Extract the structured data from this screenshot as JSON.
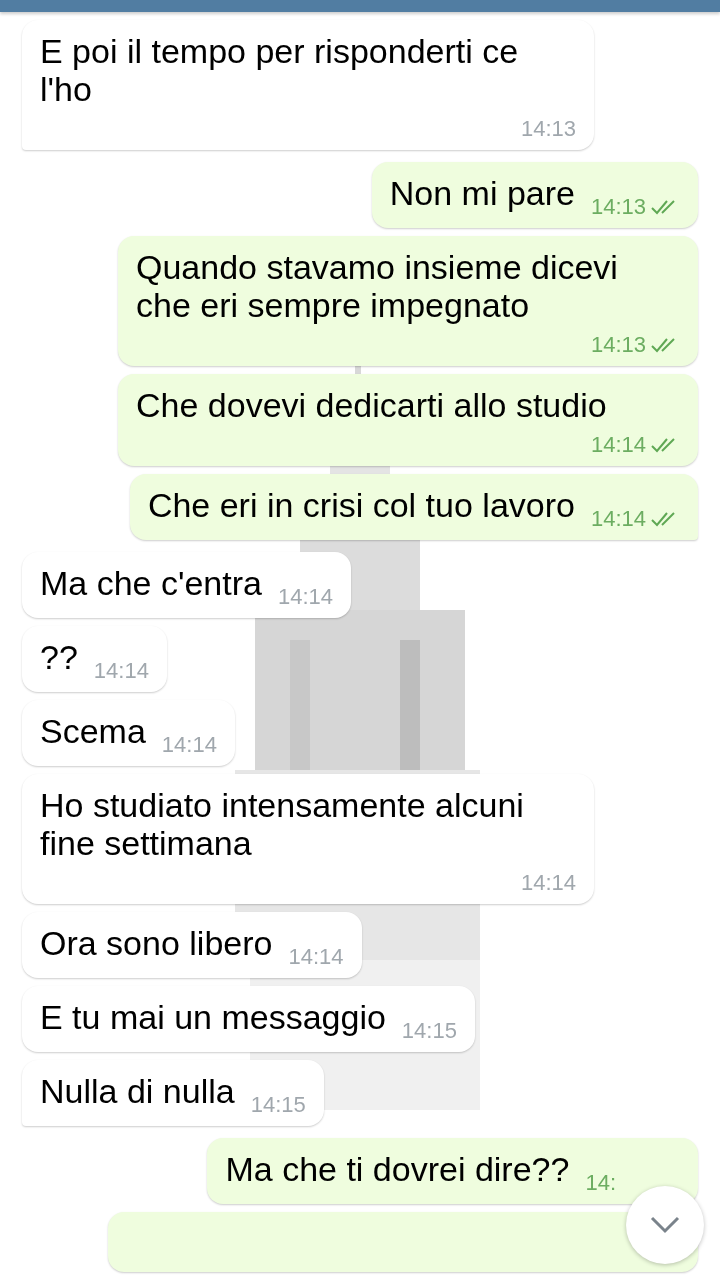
{
  "messages": [
    {
      "kind": "in",
      "text": "E poi il tempo per risponderti ce l'ho",
      "time": "14:13",
      "tail": true
    },
    {
      "kind": "out",
      "text": "Non mi pare",
      "time": "14:13",
      "read": true,
      "tail": false
    },
    {
      "kind": "out",
      "text": "Quando stavamo insieme dicevi che eri sempre impegnato",
      "time": "14:13",
      "read": true,
      "tail": false
    },
    {
      "kind": "out",
      "text": "Che dovevi dedicarti allo studio",
      "time": "14:14",
      "read": true,
      "tail": false
    },
    {
      "kind": "out",
      "text": "Che eri in crisi col tuo lavoro",
      "time": "14:14",
      "read": true,
      "tail": true
    },
    {
      "kind": "in",
      "text": "Ma che c'entra",
      "time": "14:14",
      "tail": false
    },
    {
      "kind": "in",
      "text": "??",
      "time": "14:14",
      "tail": false
    },
    {
      "kind": "in",
      "text": "Scema",
      "time": "14:14",
      "tail": false
    },
    {
      "kind": "in",
      "text": "Ho studiato intensamente alcuni fine settimana",
      "time": "14:14",
      "tail": false
    },
    {
      "kind": "in",
      "text": "Ora sono libero",
      "time": "14:14",
      "tail": false
    },
    {
      "kind": "in",
      "text": "E tu mai un messaggio",
      "time": "14:15",
      "tail": false
    },
    {
      "kind": "in",
      "text": "Nulla di nulla",
      "time": "14:15",
      "tail": true
    },
    {
      "kind": "out",
      "text": "Ma che ti dovrei dire??",
      "time": "14:"
    },
    {
      "kind": "out"
    }
  ]
}
